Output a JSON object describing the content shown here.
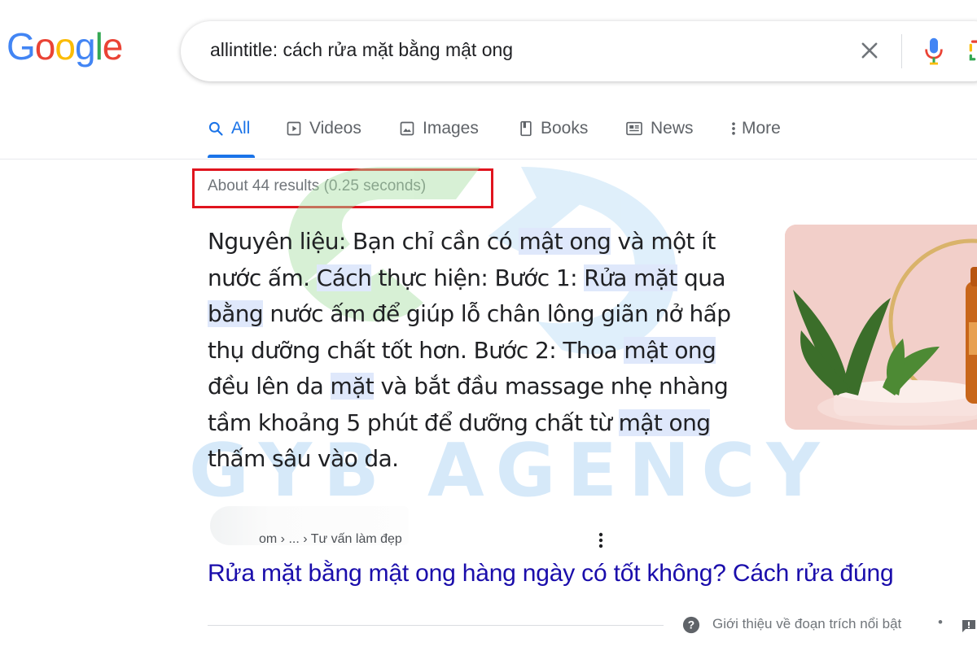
{
  "brand": {
    "logo_letters": [
      "G",
      "o",
      "o",
      "g",
      "l",
      "e"
    ],
    "logo_colors": [
      "#4285f4",
      "#ea4335",
      "#fbbc05",
      "#4285f4",
      "#34a853",
      "#ea4335"
    ]
  },
  "search": {
    "query": "allintitle: cách rửa mặt bằng mật ong"
  },
  "tabs": [
    {
      "label": "All",
      "icon": "search-icon",
      "active": true
    },
    {
      "label": "Videos",
      "icon": "play-icon"
    },
    {
      "label": "Images",
      "icon": "image-icon"
    },
    {
      "label": "Books",
      "icon": "book-icon"
    },
    {
      "label": "News",
      "icon": "newspaper-icon"
    },
    {
      "label": "More",
      "icon": "more-vert-icon"
    }
  ],
  "stats": "About 44 results (0.25 seconds)",
  "featured_snippet": {
    "lines": [
      [
        {
          "t": "Nguyên liệu: Bạn chỉ cần có "
        },
        {
          "t": "mật ong",
          "hl": true
        },
        {
          "t": " và một ít"
        }
      ],
      [
        {
          "t": "nước ấm. "
        },
        {
          "t": "Cách",
          "hl": true
        },
        {
          "t": " thực hiện: Bước 1: "
        },
        {
          "t": "Rửa mặt",
          "hl": true
        },
        {
          "t": " qua"
        }
      ],
      [
        {
          "t": "bằng",
          "hl": true
        },
        {
          "t": " nước ấm để giúp lỗ chân lông giãn nở hấp"
        }
      ],
      [
        {
          "t": "thụ dưỡng chất tốt hơn. Bước 2: Thoa "
        },
        {
          "t": "mật ong",
          "hl": true
        }
      ],
      [
        {
          "t": "đều lên da "
        },
        {
          "t": "mặt",
          "hl": true
        },
        {
          "t": " và bắt đầu massage nhẹ nhàng"
        }
      ],
      [
        {
          "t": "tầm khoảng 5 phút để dưỡng chất từ "
        },
        {
          "t": "mật ong",
          "hl": true
        }
      ],
      [
        {
          "t": "thấm sâu vào da."
        }
      ]
    ]
  },
  "result": {
    "breadcrumb": "om › ... › Tư vấn làm đẹp",
    "title": "Rửa mặt bằng mật ong hàng ngày có tốt không? Cách rửa đúng"
  },
  "footer": {
    "about_label": "Giới thiệu về đoạn trích nổi bật",
    "separator": "•"
  },
  "watermark": {
    "text": "GYB AGENCY",
    "color": "#b9dcf6"
  },
  "colors": {
    "accent": "#1a73e8",
    "link": "#1a0dab",
    "highlight_box": "#e0141e",
    "snippet_highlight": "#dfe8fb"
  }
}
